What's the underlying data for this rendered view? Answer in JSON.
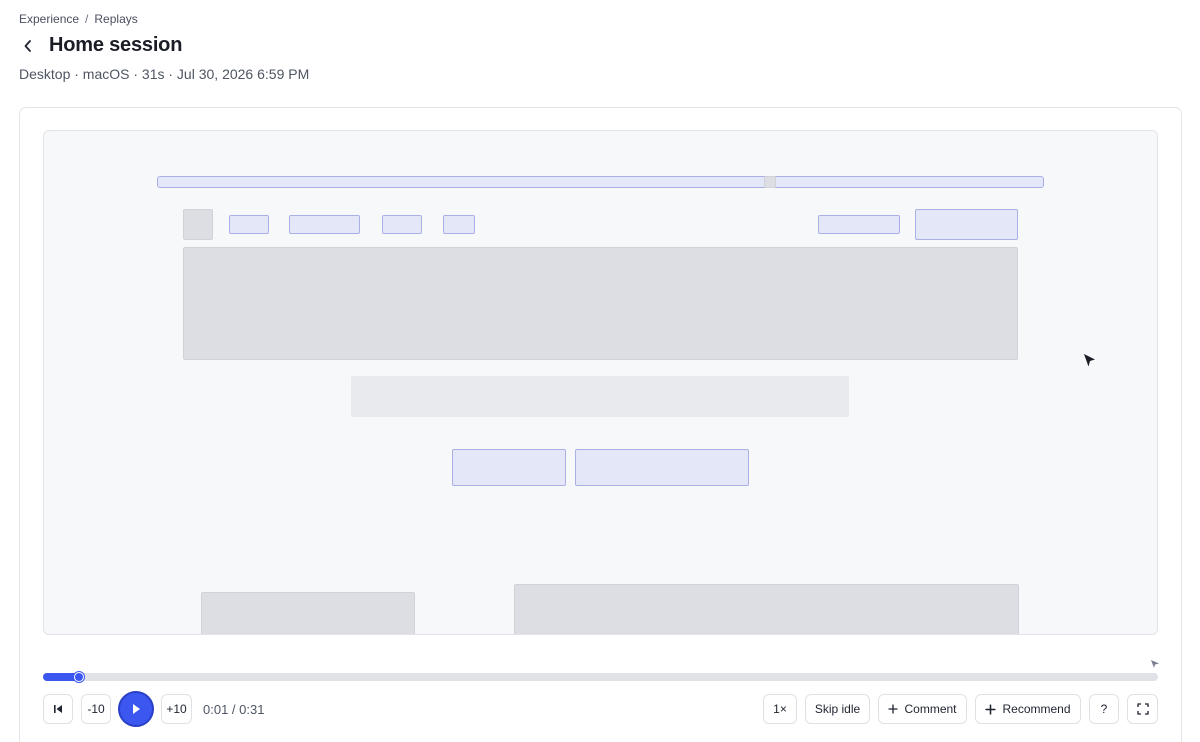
{
  "breadcrumb": {
    "items": [
      "Experience",
      "Replays"
    ],
    "separator": "/"
  },
  "header": {
    "title": "Home session"
  },
  "session": {
    "meta": "Desktop · macOS · 31s · Jul 30, 2026 6:59 PM"
  },
  "player": {
    "current_time": "0:01",
    "duration": "0:31",
    "time_display": "0:01 / 0:31",
    "progress": 0.032,
    "controls": {
      "rewind_label": "-10",
      "forward_label": "+10",
      "speed_label": "1×",
      "skip_idle_label": "Skip idle",
      "comment_label": "Comment",
      "recommend_label": "Recommend",
      "help_label": "?"
    }
  },
  "icons": {
    "back": "chevron-left-icon",
    "restart": "skip-to-start-icon",
    "play": "play-icon",
    "comment": "plus-icon",
    "recommend": "plus-icon",
    "fullscreen": "fullscreen-icon",
    "cursor": "mouse-pointer-icon"
  },
  "colors": {
    "accent": "#3b57f0",
    "wireframe_blue": "#e4e7f8",
    "wireframe_grey": "#dcdee3"
  }
}
